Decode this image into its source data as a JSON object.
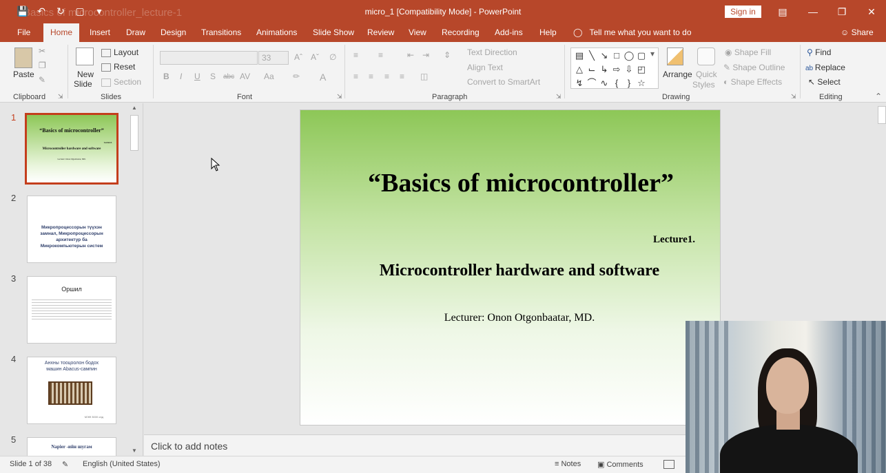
{
  "titlebar": {
    "ghost_title": "Basics of microcontroller_lecture-1",
    "doc_title": "micro_1 [Compatibility Mode] - PowerPoint",
    "sign_in": "Sign in",
    "qat_icons": [
      "save-icon",
      "undo-icon",
      "redo-icon",
      "start-slideshow-icon",
      "customize-qat-icon"
    ]
  },
  "tabs": {
    "items": [
      "File",
      "Home",
      "Insert",
      "Draw",
      "Design",
      "Transitions",
      "Animations",
      "Slide Show",
      "Review",
      "View",
      "Recording",
      "Add-ins",
      "Help"
    ],
    "tell_me": "Tell me what you want to do",
    "share": "Share"
  },
  "ribbon": {
    "clipboard": {
      "label": "Clipboard",
      "paste": "Paste"
    },
    "slides": {
      "label": "Slides",
      "new_slide_1": "New",
      "new_slide_2": "Slide",
      "layout": "Layout",
      "reset": "Reset",
      "section": "Section"
    },
    "font": {
      "label": "Font",
      "size": "33",
      "bold": "B",
      "italic": "I",
      "underline": "U",
      "shadow": "S",
      "strike": "abc",
      "spacing": "AV",
      "case": "Aa",
      "color": "A"
    },
    "paragraph": {
      "label": "Paragraph",
      "text_direction": "Text Direction",
      "align_text": "Align Text",
      "smartart": "Convert to SmartArt"
    },
    "drawing": {
      "label": "Drawing",
      "arrange": "Arrange",
      "quick_styles_1": "Quick",
      "quick_styles_2": "Styles",
      "shape_fill": "Shape Fill",
      "shape_outline": "Shape Outline",
      "shape_effects": "Shape Effects"
    },
    "editing": {
      "label": "Editing",
      "find": "Find",
      "replace": "Replace",
      "select": "Select"
    }
  },
  "thumbnails": [
    {
      "num": "1",
      "title": "“Basics of microcontroller”",
      "sub": "Microcontroller hardware and software",
      "small": "Lecture1.",
      "lecturer": "Lecturer: Onon Otgonbaatar, MD."
    },
    {
      "num": "2",
      "title": "Микропроцессорын түүхэн замнал, Микропроцессорын архитектур ба Микрокомпьютерын систем"
    },
    {
      "num": "3",
      "title": "Оршил"
    },
    {
      "num": "4",
      "title": "Анхны тооцоолон бодох машин Abacus-сампин",
      "caption": "МЭӨ 3000 онд"
    },
    {
      "num": "5",
      "title": "Napier -ийн шугам"
    }
  ],
  "slide": {
    "title": "“Basics of microcontroller”",
    "lecture": "Lecture1.",
    "subtitle": "Microcontroller hardware and software",
    "lecturer": "Lecturer: Onon Otgonbaatar, MD."
  },
  "notes": {
    "placeholder": "Click to add notes"
  },
  "status": {
    "slide_info": "Slide 1 of 38",
    "language": "English (United States)",
    "notes": "Notes",
    "comments": "Comments"
  }
}
